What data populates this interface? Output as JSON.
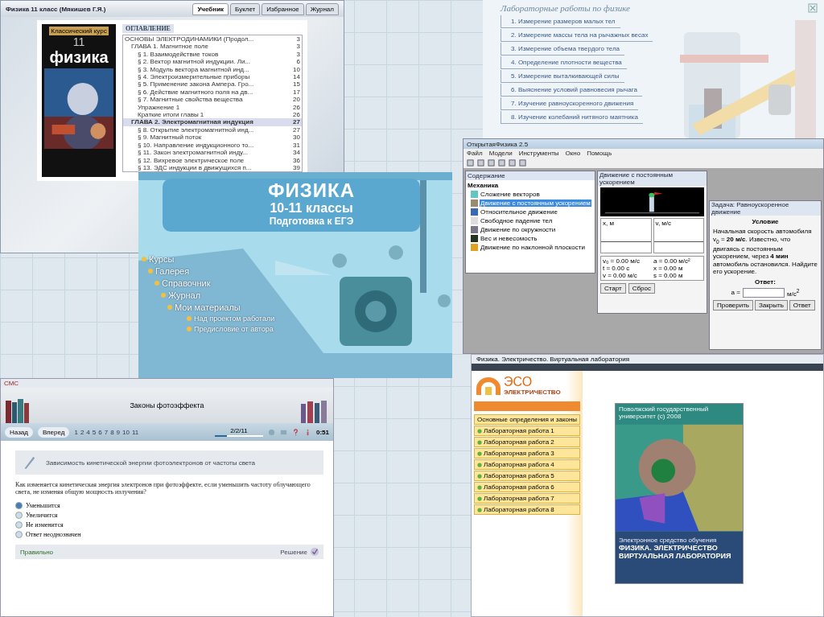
{
  "textbook_window": {
    "title": "Физика 11 класс (Мякишев Г.Я.)",
    "tabs": [
      {
        "label": "Учебник",
        "selected": true
      },
      {
        "label": "Буклет",
        "selected": false
      },
      {
        "label": "Избранное",
        "selected": false
      },
      {
        "label": "Журнал",
        "selected": false
      }
    ],
    "cover": {
      "series": "Классический курс",
      "grade": "11",
      "title": "физика"
    },
    "toc": {
      "heading": "ОГЛАВЛЕНИЕ",
      "items": [
        {
          "title": "ОСНОВЫ ЭЛЕКТРОДИНАМИКИ (Продол...",
          "page": "3",
          "selected": false,
          "children": [
            {
              "title": "ГЛАВА 1. Магнитное поле",
              "page": "3",
              "selected": false,
              "children": [
                {
                  "title": "§ 1. Взаимодействие токов",
                  "page": "3",
                  "selected": false
                },
                {
                  "title": "§ 2. Вектор магнитной индукции. Ли...",
                  "page": "6",
                  "selected": false
                },
                {
                  "title": "§ 3. Модуль вектора магнитной инд...",
                  "page": "10",
                  "selected": false
                },
                {
                  "title": "§ 4. Электроизмерительные приборы",
                  "page": "14",
                  "selected": false
                },
                {
                  "title": "§ 5. Применение закона Ампера. Гро...",
                  "page": "15",
                  "selected": false
                },
                {
                  "title": "§ 6. Действие магнитного поля на дв...",
                  "page": "17",
                  "selected": false
                },
                {
                  "title": "§ 7. Магнитные свойства вещества",
                  "page": "20",
                  "selected": false
                },
                {
                  "title": "Упражнение 1",
                  "page": "26",
                  "selected": false
                },
                {
                  "title": "Краткие итоги главы 1",
                  "page": "26",
                  "selected": false
                }
              ]
            },
            {
              "title": "ГЛАВА 2. Электромагнитная индукция",
              "page": "27",
              "selected": true,
              "children": [
                {
                  "title": "§ 8. Открытие электромагнитной инд...",
                  "page": "27",
                  "selected": false
                },
                {
                  "title": "§ 9. Магнитный поток",
                  "page": "30",
                  "selected": false
                },
                {
                  "title": "§ 10. Направление индукционного то...",
                  "page": "31",
                  "selected": false
                },
                {
                  "title": "§ 11. Закон электромагнитной инду...",
                  "page": "34",
                  "selected": false
                },
                {
                  "title": "§ 12. Вихревое электрическое поле",
                  "page": "36",
                  "selected": false
                },
                {
                  "title": "§ 13. ЭДС индукции в движущихся п...",
                  "page": "39",
                  "selected": false
                }
              ]
            }
          ]
        }
      ]
    }
  },
  "lab_window": {
    "title": "Лабораторные работы по физике",
    "items": [
      "1. Измерение размеров малых тел",
      "2. Измерение массы тела на рычажных весах",
      "3. Измерение объема твердого тела",
      "4. Определение плотности вещества",
      "5. Измерение выталкивающей силы",
      "6. Выяснение условий равновесия рычага",
      "7. Изучение равноускоренного движения",
      "8. Изучение колебаний нитяного маятника"
    ]
  },
  "splash": {
    "title": "ФИЗИКА",
    "subtitle": "10-11 классы",
    "exam": "Подготовка к ЕГЭ",
    "menu": [
      {
        "label": "Курсы",
        "kind": "main"
      },
      {
        "label": "Галерея",
        "kind": "main"
      },
      {
        "label": "Справочник",
        "kind": "main"
      },
      {
        "label": "Журнал",
        "kind": "main"
      },
      {
        "label": "Мои материалы",
        "kind": "main"
      },
      {
        "label": "Над проектом работали",
        "kind": "sub"
      },
      {
        "label": "Предисловие от автора",
        "kind": "sub"
      }
    ]
  },
  "open_physics": {
    "title": "ОткрытаяФизика 2.5",
    "menu": [
      "Файл",
      "Модели",
      "Инструменты",
      "Окно",
      "Помощь"
    ],
    "contents": {
      "title": "Содержание",
      "root": "Механика",
      "items": [
        {
          "label": "Сложение векторов",
          "selected": false
        },
        {
          "label": "Движение с постоянным ускорением",
          "selected": true
        },
        {
          "label": "Относительное движение",
          "selected": false
        },
        {
          "label": "Свободное падение тел",
          "selected": false
        },
        {
          "label": "Движение по окружности",
          "selected": false
        },
        {
          "label": "Вес и невесомость",
          "selected": false
        },
        {
          "label": "Движение по наклонной плоскости",
          "selected": false
        }
      ]
    },
    "sim": {
      "title": "Движение с постоянным ускорением",
      "graphs": [
        "x, м",
        "v, м/с"
      ],
      "readouts": [
        "v₀ = 0.00 м/с",
        "a = 0.00 м/с²",
        "t = 0.00 c",
        "x = 0.00 м",
        "v = 0.00 м/с",
        "s = 0.00 м"
      ],
      "buttons": [
        "Старт",
        "Сброс"
      ]
    },
    "task": {
      "title": "Задача: Равноускоренное движение",
      "heading": "Условие",
      "text": "Начальная скорость автомобиля v$_{0}$ = **20 м/с**. Известно, что двигаясь с постоянным ускорением, через **4 мин** автомобиль остановился. Найдите его ускорение.",
      "answer_heading": "Ответ:",
      "answer_label": "a =",
      "unit": "м/с$^{2}$",
      "buttons": [
        "Проверить",
        "Закрыть",
        "Ответ"
      ]
    }
  },
  "quiz": {
    "app_title": "СМС",
    "title": "Законы фотоэффекта",
    "nav": [
      "Назад",
      "Вперед"
    ],
    "pages": [
      "1",
      "2",
      "4",
      "5",
      "6",
      "7",
      "8",
      "9",
      "10",
      "11"
    ],
    "progress_text": "2/2/11",
    "level": 0.25,
    "timer": "0:51",
    "topic": "Зависимость кинетической энергии фотоэлектронов от частоты света",
    "question": "Как изменяется кинетическая энергия электронов при фотоэффекте, если уменьшить частоту облучающего света, не изменяя общую мощность излучения?",
    "options": [
      {
        "label": "Уменьшится",
        "selected": true
      },
      {
        "label": "Увеличится",
        "selected": false
      },
      {
        "label": "Не изменится",
        "selected": false
      },
      {
        "label": "Ответ неоднозначен",
        "selected": false
      }
    ],
    "status": "Правильно",
    "solution": "Решение"
  },
  "eso": {
    "title": "Физика. Электричество. Виртуальная лаборатория",
    "logo": "ЭСО",
    "logo_sub": "ЭЛЕКТРИЧЕСТВО",
    "menu": [
      "Основные определения и законы",
      "Лабораторная работа 1",
      "Лабораторная работа 2",
      "Лабораторная работа 3",
      "Лабораторная работа 4",
      "Лабораторная работа 5",
      "Лабораторная работа 6",
      "Лабораторная работа 7",
      "Лабораторная работа 8"
    ],
    "cover": {
      "publisher": "Поволжский государственный университет (с) 2008",
      "kind": "Электронное средство обучения",
      "title": "ФИЗИКА. ЭЛЕКТРИЧЕСТВО",
      "subtitle": "ВИРТУАЛЬНАЯ ЛАБОРАТОРИЯ"
    }
  }
}
